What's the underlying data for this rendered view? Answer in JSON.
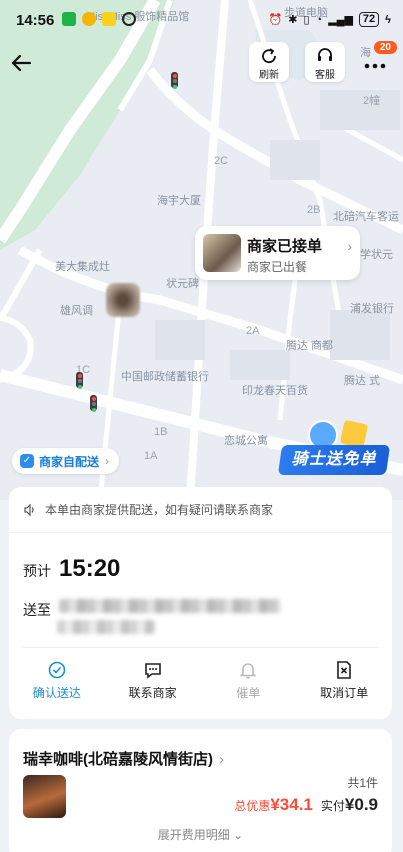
{
  "status_bar": {
    "time": "14:56",
    "battery": "72"
  },
  "top_buttons": {
    "refresh": "刷新",
    "service": "客服",
    "badge_count": "20"
  },
  "map_labels": {
    "top_left": "MissMiss 服饰精品馆",
    "top_right": "步道电脑",
    "hai": "海",
    "haiyu": "海宇大厦",
    "beipei": "北碚汽车客运",
    "meida": "美大集成灶",
    "zhuang": "状元碑",
    "yifeng": "雄风调",
    "post": "中国邮政储蓄银行",
    "yinlong": "印龙春天百货",
    "tengda": "腾达 商都",
    "pufa": "浦发银行",
    "tengda2": "腾达 式",
    "hengwei": "恋城公寓",
    "fuyao": "学状元",
    "jinyun": "缙云",
    "one_a": "1A",
    "one_b": "1B",
    "one_c": "1C",
    "two_a": "2A",
    "two_b": "2B",
    "two_c": "2C",
    "two_hao": "2幢"
  },
  "rider_card": {
    "title": "商家已接单",
    "subtitle": "商家已出餐"
  },
  "promo": {
    "label": "骑士送免单"
  },
  "merchant_tag": {
    "label": "商家自配送"
  },
  "delivery": {
    "notice": "本单由商家提供配送，如有疑问请联系商家",
    "eta_label": "预计",
    "eta_time": "15:20",
    "address_label": "送至"
  },
  "actions": [
    {
      "label": "确认送达",
      "icon": "check-circle-icon"
    },
    {
      "label": "联系商家",
      "icon": "chat-icon"
    },
    {
      "label": "催单",
      "icon": "bell-icon"
    },
    {
      "label": "取消订单",
      "icon": "cancel-doc-icon"
    }
  ],
  "store": {
    "name": "瑞幸咖啡(北碚嘉陵风情街店)",
    "item_count": "共1件",
    "discount_label": "总优惠",
    "discount_value": "¥34.1",
    "paid_label": "实付",
    "paid_value": "¥0.9",
    "expand": "展开费用明细"
  },
  "colors": {
    "accent": "#1a8fd6",
    "discount": "#ff4a3a",
    "badge": "#ff5a1f"
  }
}
